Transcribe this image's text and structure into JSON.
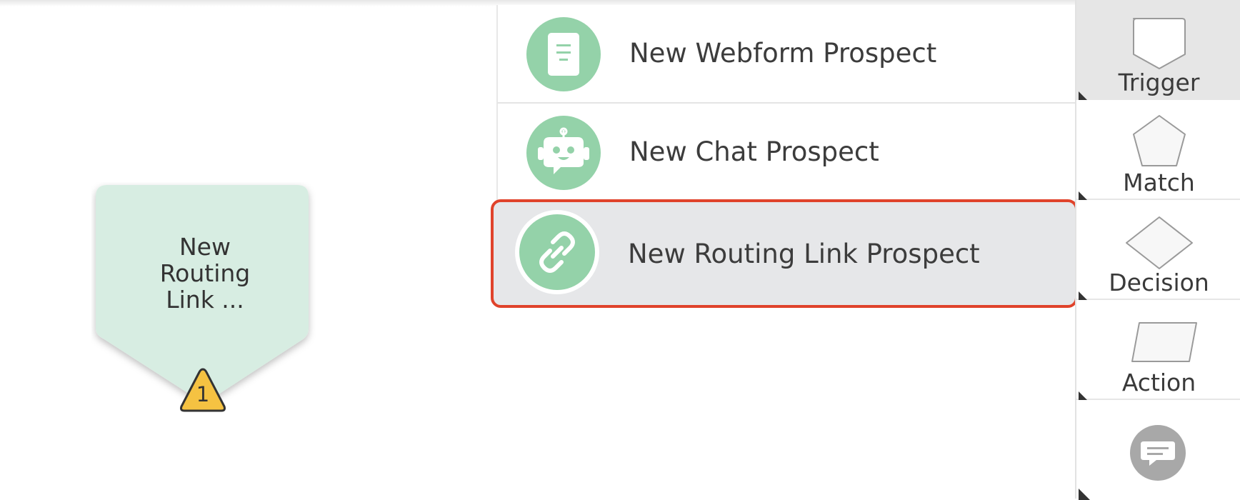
{
  "canvas": {
    "node": {
      "label_line1": "New",
      "label_line2": "Routing",
      "label_line3": "Link ...",
      "warning_count": "1"
    }
  },
  "trigger_menu": {
    "items": [
      {
        "label": "New Webform Prospect",
        "icon": "webform-document-icon"
      },
      {
        "label": "New Chat Prospect",
        "icon": "chat-robot-icon"
      },
      {
        "label": "New Routing Link Prospect",
        "icon": "link-chain-icon",
        "selected": true
      }
    ]
  },
  "toolbar": {
    "tools": [
      {
        "label": "Trigger",
        "icon": "trigger-shape-icon",
        "active": true
      },
      {
        "label": "Match",
        "icon": "pentagon-icon"
      },
      {
        "label": "Decision",
        "icon": "diamond-icon"
      },
      {
        "label": "Action",
        "icon": "parallelogram-icon"
      },
      {
        "label": "",
        "icon": "comment-icon"
      }
    ]
  },
  "colors": {
    "node_fill": "#d7ede2",
    "icon_green": "#94d2a9",
    "warning_yellow": "#f5c242",
    "selection_border": "#e0432b",
    "selected_bg": "#e6e7e9"
  }
}
